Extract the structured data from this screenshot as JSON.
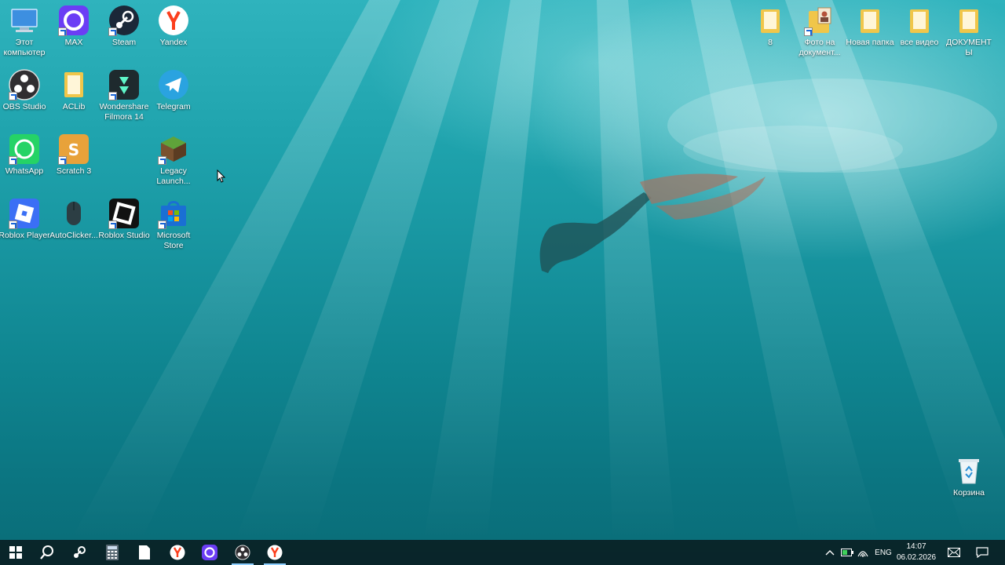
{
  "desktop": {
    "icons_left": [
      {
        "label": "Этот компьютер"
      },
      {
        "label": "MAX"
      },
      {
        "label": "Steam"
      },
      {
        "label": "Yandex"
      },
      {
        "label": "OBS Studio"
      },
      {
        "label": "ACLib"
      },
      {
        "label": "Wondershare Filmora 14"
      },
      {
        "label": "Telegram"
      },
      {
        "label": "WhatsApp"
      },
      {
        "label": "Scratch 3"
      },
      {
        "label": "Legacy Launch..."
      },
      {
        "label": "Roblox Player"
      },
      {
        "label": "AutoClicker..."
      },
      {
        "label": "Roblox Studio"
      },
      {
        "label": "Microsoft Store"
      }
    ],
    "icons_right": [
      {
        "label": "8"
      },
      {
        "label": "Фото на документ..."
      },
      {
        "label": "Новая папка"
      },
      {
        "label": "все видео"
      },
      {
        "label": "ДОКУМЕНТЫ"
      }
    ],
    "recycle_bin": {
      "label": "Корзина"
    }
  },
  "taskbar": {
    "language": "ENG",
    "time": "14:07",
    "date": "06.02.2026"
  },
  "colors": {
    "taskbar": "#0a2024",
    "folder": "#f0c64a",
    "steam": "#1b2838",
    "yandex": "#fc3f1d",
    "telegram": "#2aa3e0",
    "whatsapp": "#25d366",
    "max": "#6b3df5",
    "scratch": "#e8a23a"
  }
}
